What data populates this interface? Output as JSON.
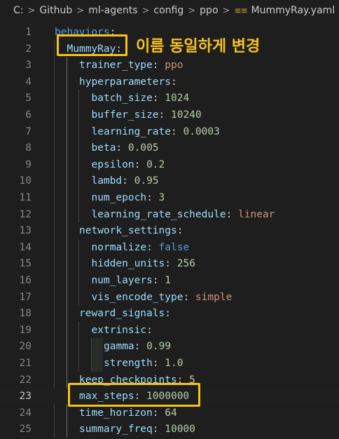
{
  "breadcrumb": {
    "items": [
      "C:",
      "Github",
      "ml-agents",
      "config",
      "ppo"
    ],
    "file_icon": "yaml-icon",
    "file_name": "MummyRay.yaml"
  },
  "annotation": "이름 동일하게 변경",
  "highlight_color": "#f7c21b",
  "current_line": 23,
  "lines": [
    {
      "n": "1",
      "indent": 0,
      "key": "behaviors",
      "val": "",
      "type": "k"
    },
    {
      "n": "2",
      "indent": 1,
      "key": "MummyRay",
      "val": "",
      "type": "kc"
    },
    {
      "n": "3",
      "indent": 2,
      "key": "trainer_type",
      "val": "ppo",
      "type": "s"
    },
    {
      "n": "4",
      "indent": 2,
      "key": "hyperparameters",
      "val": "",
      "type": "kc"
    },
    {
      "n": "5",
      "indent": 3,
      "key": "batch_size",
      "val": "1024",
      "type": "n"
    },
    {
      "n": "6",
      "indent": 3,
      "key": "buffer_size",
      "val": "10240",
      "type": "n"
    },
    {
      "n": "7",
      "indent": 3,
      "key": "learning_rate",
      "val": "0.0003",
      "type": "n"
    },
    {
      "n": "8",
      "indent": 3,
      "key": "beta",
      "val": "0.005",
      "type": "n"
    },
    {
      "n": "9",
      "indent": 3,
      "key": "epsilon",
      "val": "0.2",
      "type": "n"
    },
    {
      "n": "10",
      "indent": 3,
      "key": "lambd",
      "val": "0.95",
      "type": "n"
    },
    {
      "n": "11",
      "indent": 3,
      "key": "num_epoch",
      "val": "3",
      "type": "n"
    },
    {
      "n": "12",
      "indent": 3,
      "key": "learning_rate_schedule",
      "val": "linear",
      "type": "s"
    },
    {
      "n": "13",
      "indent": 2,
      "key": "network_settings",
      "val": "",
      "type": "kc"
    },
    {
      "n": "14",
      "indent": 3,
      "key": "normalize",
      "val": "false",
      "type": "k"
    },
    {
      "n": "15",
      "indent": 3,
      "key": "hidden_units",
      "val": "256",
      "type": "n"
    },
    {
      "n": "16",
      "indent": 3,
      "key": "num_layers",
      "val": "1",
      "type": "n"
    },
    {
      "n": "17",
      "indent": 3,
      "key": "vis_encode_type",
      "val": "simple",
      "type": "s"
    },
    {
      "n": "18",
      "indent": 2,
      "key": "reward_signals",
      "val": "",
      "type": "kc"
    },
    {
      "n": "19",
      "indent": 3,
      "key": "extrinsic",
      "val": "",
      "type": "kc"
    },
    {
      "n": "20",
      "indent": 4,
      "key": "gamma",
      "val": "0.99",
      "type": "n"
    },
    {
      "n": "21",
      "indent": 4,
      "key": "strength",
      "val": "1.0",
      "type": "n"
    },
    {
      "n": "22",
      "indent": 2,
      "key": "keep_checkpoints",
      "val": "5",
      "type": "n"
    },
    {
      "n": "23",
      "indent": 2,
      "key": "max_steps",
      "val": "1000000",
      "type": "n"
    },
    {
      "n": "24",
      "indent": 2,
      "key": "time_horizon",
      "val": "64",
      "type": "n"
    },
    {
      "n": "25",
      "indent": 2,
      "key": "summary_freq",
      "val": "10000",
      "type": "n"
    }
  ]
}
